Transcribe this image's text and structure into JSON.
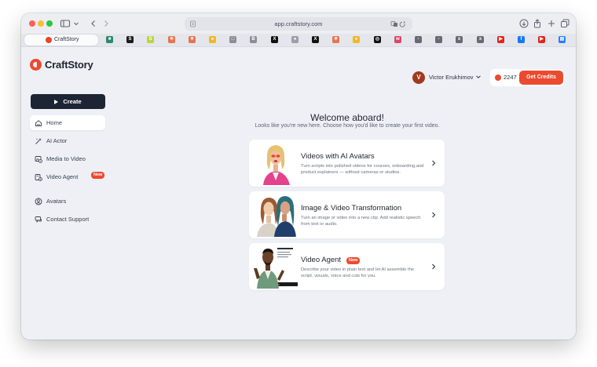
{
  "browser": {
    "url": "app.craftstory.com",
    "active_tab": {
      "title": "CraftStory",
      "icon": "craftstory-icon"
    },
    "pinned_tabs": [
      {
        "icon": "app-tab-icon",
        "color": "#2b8a6e",
        "glyph": "■"
      },
      {
        "icon": "s-tab-icon",
        "color": "#1b1b1b",
        "glyph": "S"
      },
      {
        "icon": "sp-tab-icon",
        "color": "#b9d63a",
        "glyph": "S"
      },
      {
        "icon": "asterisk-tab-icon",
        "color": "#e8734f",
        "glyph": "✳"
      },
      {
        "icon": "asterisk-tab-icon",
        "color": "#e8734f",
        "glyph": "✳"
      },
      {
        "icon": "bulb-tab-icon",
        "color": "#f2b825",
        "glyph": "●"
      },
      {
        "icon": "square-tab-icon",
        "color": "#8a8e98",
        "glyph": "□"
      },
      {
        "icon": "b-tab-icon",
        "color": "#8a8e98",
        "glyph": "B"
      },
      {
        "icon": "x-tab-icon",
        "color": "#111111",
        "glyph": "X"
      },
      {
        "icon": "globe-tab-icon",
        "color": "#9aa0aa",
        "glyph": "●"
      },
      {
        "icon": "x-tab-icon",
        "color": "#111111",
        "glyph": "X"
      },
      {
        "icon": "asterisk-tab-icon",
        "color": "#e8734f",
        "glyph": "✳"
      },
      {
        "icon": "bulb-tab-icon",
        "color": "#f2b825",
        "glyph": "●"
      },
      {
        "icon": "openai-tab-icon",
        "color": "#111111",
        "glyph": "◎"
      },
      {
        "icon": "w-tab-icon",
        "color": "#d9476a",
        "glyph": "w"
      },
      {
        "icon": "dash-tab-icon",
        "color": "#666a74",
        "glyph": "-"
      },
      {
        "icon": "dash-tab-icon",
        "color": "#666a74",
        "glyph": "-"
      },
      {
        "icon": "x-small-tab-icon",
        "color": "#666a74",
        "glyph": "x"
      },
      {
        "icon": "x-small-tab-icon",
        "color": "#666a74",
        "glyph": "x"
      },
      {
        "icon": "youtube-tab-icon",
        "color": "#e0261d",
        "glyph": "▶"
      },
      {
        "icon": "facebook-tab-icon",
        "color": "#1877f2",
        "glyph": "f"
      },
      {
        "icon": "youtube-tab-icon",
        "color": "#e0261d",
        "glyph": "▶"
      },
      {
        "icon": "docs-tab-icon",
        "color": "#2e7cf6",
        "glyph": "▤"
      }
    ]
  },
  "brand": {
    "name": "CraftStory",
    "accent": "#ec4a2f",
    "dark": "#1d2535"
  },
  "sidebar": {
    "create_label": "Create",
    "items": [
      {
        "label": "Home",
        "icon": "home-icon",
        "active": true
      },
      {
        "label": "AI Actor",
        "icon": "sparkle-wand-icon"
      },
      {
        "label": "Media to Video",
        "icon": "image-video-icon"
      },
      {
        "label": "Video Agent",
        "icon": "video-agent-icon",
        "badge": "New"
      },
      {
        "label": "Avatars",
        "icon": "user-circle-icon"
      },
      {
        "label": "Contact Support",
        "icon": "chat-icon"
      }
    ]
  },
  "header": {
    "user_initial": "V",
    "user_name": "Victor Erukhimov",
    "credits": "2247",
    "get_credits_label": "Get Credits"
  },
  "main": {
    "title": "Welcome aboard!",
    "subtitle": "Looks like you're new here. Choose how you'd like to create your first video.",
    "cards": [
      {
        "title": "Videos with AI Avatars",
        "description": "Turn scripts into polished videos for courses, onboarding,and product explainers — without cameras or studios."
      },
      {
        "title": "Image & Video Transformation",
        "description": "Turn an image or video into a new clip. Add realistic speech from text or audio."
      },
      {
        "title": "Video Agent",
        "badge": "New",
        "description": "Describe your video in plain text and let AI assemble the script, visuals, voice and cuts for you."
      }
    ]
  }
}
